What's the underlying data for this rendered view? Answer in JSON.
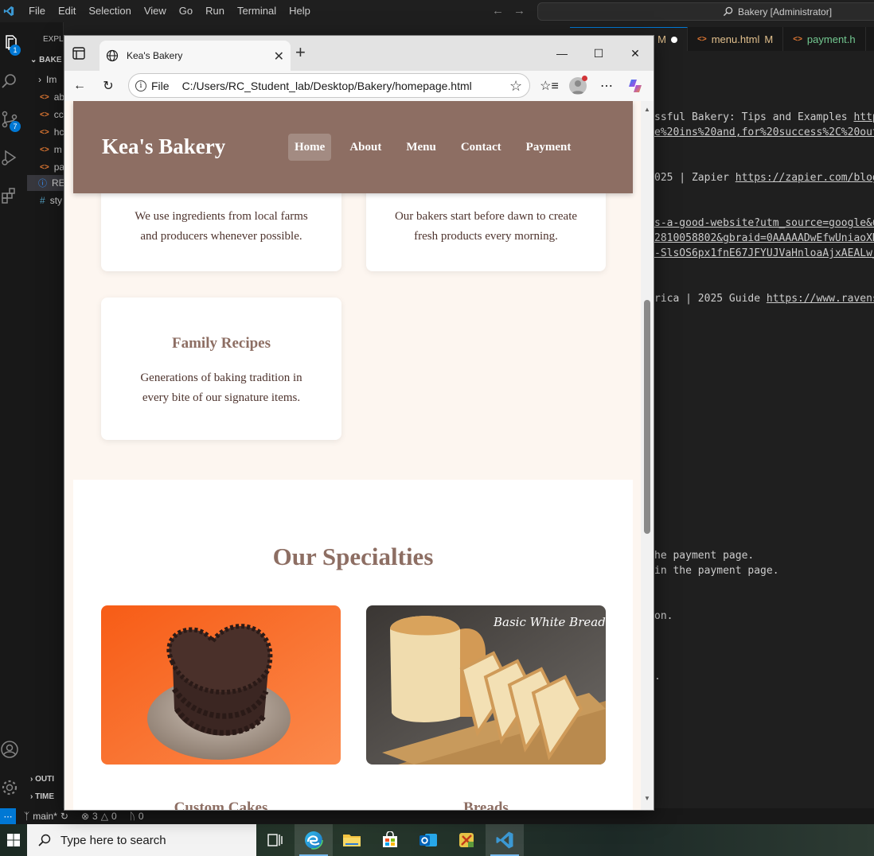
{
  "vscode": {
    "menu": [
      "File",
      "Edit",
      "Selection",
      "View",
      "Go",
      "Run",
      "Terminal",
      "Help"
    ],
    "search_text": "Bakery [Administrator]",
    "explorer_label": "EXPLO",
    "folder_label": "BAKE",
    "files": [
      {
        "prefix": "Im",
        "kind": "folder"
      },
      {
        "prefix": "ab",
        "kind": "html"
      },
      {
        "prefix": "cc",
        "kind": "html"
      },
      {
        "prefix": "hc",
        "kind": "html"
      },
      {
        "prefix": "m",
        "kind": "html"
      },
      {
        "prefix": "pa",
        "kind": "html"
      },
      {
        "prefix": "RE",
        "kind": "info"
      },
      {
        "prefix": "sty",
        "kind": "css"
      }
    ],
    "outline_label": "OUTI",
    "timeline_label": "TIME",
    "badges": {
      "explorer": "1",
      "scm": "7"
    },
    "tabs": [
      {
        "label": "M",
        "status": "",
        "modified_dot": true
      },
      {
        "label": "menu.html",
        "status": "M",
        "modified_dot": false
      },
      {
        "label": "payment.h",
        "status": "",
        "modified_dot": false
      }
    ],
    "editor_lines": [
      {
        "text": "ssful Bakery: Tips and Examples ",
        "link": "http"
      },
      {
        "text": "",
        "link": "e%20ins%20and,for%20success%2C%20out"
      },
      {
        "text": "025 | Zapier ",
        "link": "https://zapier.com/blog"
      },
      {
        "text": "",
        "link": "s-a-good-website?utm_source=google&u"
      },
      {
        "text": "",
        "link": "2810058802&gbraid=0AAAAADwEfwUniaoXN"
      },
      {
        "text": "",
        "link": "-SlsOS6px1fnE67JFYUJVaHnloaAjxAEALw_"
      },
      {
        "text": "rica | 2025 Guide ",
        "link": "https://www.ravens"
      },
      {
        "text": "he payment page.",
        "link": ""
      },
      {
        "text": "in the payment page.",
        "link": ""
      },
      {
        "text": "on.",
        "link": ""
      },
      {
        "text": ".",
        "link": ""
      }
    ],
    "status": {
      "branch": "main*",
      "errors": "3",
      "warnings": "0",
      "ports": "0"
    }
  },
  "taskbar": {
    "search_placeholder": "Type here to search"
  },
  "browser": {
    "tab_title": "Kea's Bakery",
    "address_prefix": "File",
    "url": "C:/Users/RC_Student_lab/Desktop/Bakery/homepage.html"
  },
  "site": {
    "logo": "Kea's Bakery",
    "nav": [
      "Home",
      "About",
      "Menu",
      "Contact",
      "Payment"
    ],
    "active_nav": "Home",
    "features": [
      {
        "title": "",
        "text_line1": "We use ingredients from local farms",
        "text_line2": "and producers whenever possible."
      },
      {
        "title": "",
        "text_line1": "Our bakers start before dawn to create",
        "text_line2": "fresh products every morning."
      },
      {
        "title": "Family Recipes",
        "text_line1": "Generations of baking tradition in",
        "text_line2": "every bite of our signature items."
      }
    ],
    "specialties_heading": "Our Specialties",
    "specialties": [
      {
        "name": "Custom Cakes",
        "image_caption": ""
      },
      {
        "name": "Breads",
        "image_caption": "Basic White Bread"
      }
    ]
  },
  "colors": {
    "header_brown": "#8d6e63",
    "page_cream": "#fdf6f0",
    "text_dark": "#4e342e",
    "vscode_accent": "#0078d4"
  }
}
